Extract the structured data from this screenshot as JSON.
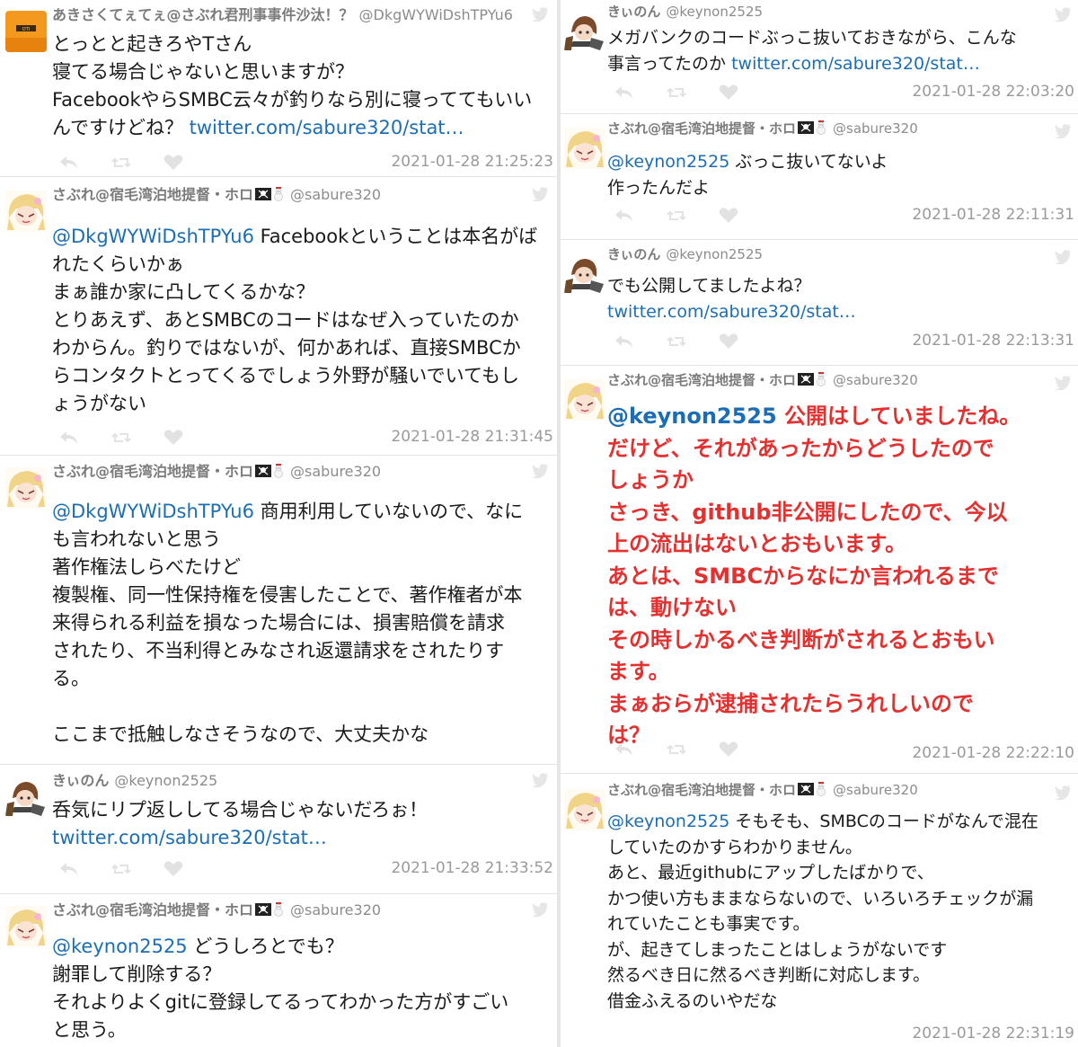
{
  "left_tweets": [
    {
      "name": "あきさくてぇてぇ@さぶれ君刑事事件沙汰！？",
      "handle": "@DkgWYWiDshTPYu6",
      "lines": [
        "とっとと起きろやTさん",
        "寝てる場合じゃないと思いますが？",
        "Facebookやら SMBC云々が釣りなら別に寝っててもいい"
      ],
      "mention": "",
      "text": "とっとと起きろやTさん\n寝てる場合じゃないと思いますが？\nFacebookやらSMBC云々が釣りなら別に寝っててもいい\nんですけどね？ ",
      "link": "twitter.com/sabure320/stat…",
      "timestamp": "2021-01-28 21:25:23",
      "avatar": "orange-shirt-avatar"
    },
    {
      "name": "さぶれ@宿毛湾泊地提督・ホロ",
      "handle": "@sabure320",
      "mention": "@DkgWYWiDshTPYu6",
      "text": " Facebookということは本名がば\nれたくらいかぁ\nまぁ誰か家に凸してくるかな？\nとりあえず、あとSMBCのコードはなぜ入っていたのか\nわからん。釣りではないが、何かあれば、直接SMBCか\nらコンタクトとってくるでしょう外野が騒いでいてもし\nょうがない",
      "link": "",
      "timestamp": "2021-01-28 21:31:45",
      "avatar": "anime-girl-avatar"
    },
    {
      "name": "さぶれ@宿毛湾泊地提督・ホロ",
      "handle": "@sabure320",
      "mention": "@DkgWYWiDshTPYu6",
      "text": " 商用利用していないので、なに\nも言われないと思う\n著作権法しらべたけど\n複製権、同一性保持権を侵害したことで、著作権者が本\n来得られる利益を損なった場合には、損害賠償を請求\nされたり、不当利得とみなされ返還請求をされたりす\nる。\n\nここまで抵触しなさそうなので、大丈夫かな",
      "link": "",
      "timestamp": "",
      "avatar": "anime-girl-avatar"
    },
    {
      "name": "きぃのん",
      "handle": "@keynon2525",
      "mention": "",
      "text": "呑気にリプ返ししてる場合じゃないだろぉ！\n",
      "link": "twitter.com/sabure320/stat…",
      "timestamp": "2021-01-28 21:33:52",
      "avatar": "brown-hair-girl-avatar"
    },
    {
      "name": "さぶれ@宿毛湾泊地提督・ホロ",
      "handle": "@sabure320",
      "mention": "@keynon2525",
      "text": " どうしろとでも？\n謝罪して削除する？\nそれよりよくgitに登録してるってわかった方がすごい\nと思う。",
      "link": "",
      "timestamp": "",
      "avatar": "anime-girl-avatar"
    }
  ],
  "right_tweets": [
    {
      "name": "きぃのん",
      "handle": "@keynon2525",
      "mention": "",
      "text": "メガバンクのコードぶっこ抜いておきながら、こんな\n事言ってたのか ",
      "link": "twitter.com/sabure320/stat…",
      "timestamp": "2021-01-28 22:03:20",
      "avatar": "brown-hair-girl-avatar"
    },
    {
      "name": "さぶれ@宿毛湾泊地提督・ホロ",
      "handle": "@sabure320",
      "mention": "@keynon2525",
      "text": " ぶっこ抜いてないよ\n作ったんだよ",
      "link": "",
      "timestamp": "2021-01-28 22:11:31",
      "avatar": "anime-girl-avatar"
    },
    {
      "name": "きぃのん",
      "handle": "@keynon2525",
      "mention": "",
      "text": "でも公開してましたよね？\n",
      "link": "twitter.com/sabure320/stat…",
      "timestamp": "2021-01-28 22:13:31",
      "avatar": "brown-hair-girl-avatar"
    },
    {
      "name": "さぶれ@宿毛湾泊地提督・ホロ",
      "handle": "@sabure320",
      "mention": "@keynon2525",
      "text": " 公開はしていましたね。\nだけど、それがあったからどうしたので\nしょうか\nさっき、github非公開にしたので、今以\n上の流出はないとおもいます。\nあとは、SMBCからなにか言われるまで\nは、動けない\nその時しかるべき判断がされるとおもい\nます。\nまぁおらが逮捕されたらうれしいので\nは？",
      "link": "",
      "timestamp": "2021-01-28 22:22:10",
      "avatar": "anime-girl-avatar",
      "highlight": true
    },
    {
      "name": "さぶれ@宿毛湾泊地提督・ホロ",
      "handle": "@sabure320",
      "mention": "@keynon2525",
      "text": " そもそも、SMBCのコードがなんで混在\nしていたのかすらわかりません。\nあと、最近githubにアップしたばかりで、\nかつ使い方もままならないので、いろいろチェックが漏\nれていたことも事実です。\nが、起きてしまったことはしょうがないです\n然るべき日に然るべき判断に対応します。\n借金ふえるのいやだな",
      "link": "",
      "timestamp": "2021-01-28 22:31:19",
      "avatar": "anime-girl-avatar"
    }
  ],
  "icons": [
    "reply-icon",
    "retweet-icon",
    "like-icon",
    "twitter-bird-icon",
    "pirate-flag-icon",
    "snowman-icon"
  ],
  "colors": {
    "link": "#1b6eb5",
    "highlight_text": "#e53030",
    "meta": "#9a9a9a",
    "name": "#7b7b7b"
  }
}
